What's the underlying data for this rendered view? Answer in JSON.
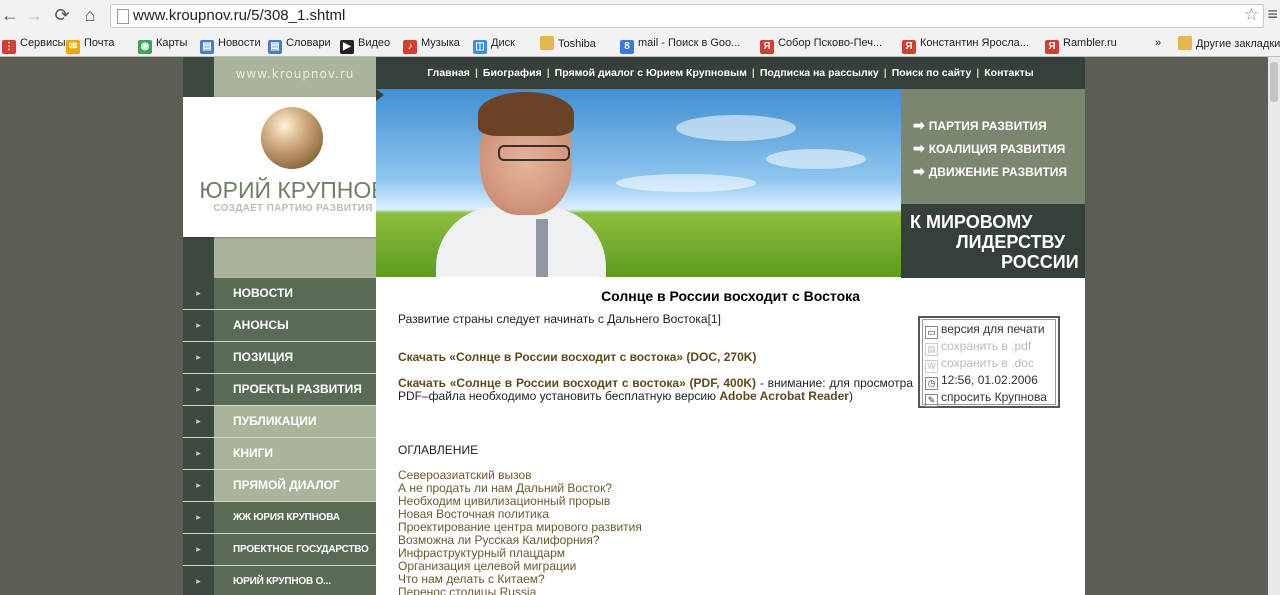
{
  "browser": {
    "url": "www.kroupnov.ru/5/308_1.shtml",
    "bookmarks": [
      {
        "label": "Сервисы",
        "icon": "apps-icon",
        "color": "#d23f31"
      },
      {
        "label": "Почта",
        "icon": "mail-icon",
        "color": "#f0a800"
      },
      {
        "label": "Карты",
        "icon": "maps-icon",
        "color": "#3aa757"
      },
      {
        "label": "Новости",
        "icon": "news-icon",
        "color": "#4a7bc8"
      },
      {
        "label": "Словари",
        "icon": "dictionary-icon",
        "color": "#4a7bc8"
      },
      {
        "label": "Видео",
        "icon": "video-icon",
        "color": "#222222"
      },
      {
        "label": "Музыка",
        "icon": "music-icon",
        "color": "#d23f31"
      },
      {
        "label": "Диск",
        "icon": "disk-icon",
        "color": "#3b8de0"
      },
      {
        "label": "Toshiba",
        "icon": "folder-icon",
        "color": "#e6b84b"
      },
      {
        "label": "mail - Поиск в Goo...",
        "icon": "google-icon",
        "color": "#3b78e7"
      },
      {
        "label": "Собор Псково-Печ...",
        "icon": "yandex-icon",
        "color": "#d23f31"
      },
      {
        "label": "Константин Яросла...",
        "icon": "yandex-icon",
        "color": "#d23f31"
      },
      {
        "label": "Rambler.ru",
        "icon": "yandex-icon",
        "color": "#d23f31"
      }
    ],
    "overflow": "»",
    "other_bookmarks": "Другие закладки"
  },
  "site": {
    "name": "www.kroupnov.ru",
    "logo_title": "ЮРИЙ КРУПНОВ",
    "logo_tagline": "СОЗДАЕТ ПАРТИЮ РАЗВИТИЯ",
    "topnav": [
      "Главная",
      "Биография",
      "Прямой диалог с Юрием Крупновым",
      "Подписка на рассылку",
      "Поиск по сайту",
      "Контакты"
    ],
    "right_links": [
      "ПАРТИЯ РАЗВИТИЯ",
      "КОАЛИЦИЯ РАЗВИТИЯ",
      "ДВИЖЕНИЕ РАЗВИТИЯ"
    ],
    "motto": [
      "К МИРОВОМУ",
      "ЛИДЕРСТВУ",
      "РОССИИ"
    ],
    "sidenav": [
      {
        "label": "НОВОСТИ",
        "style": "dark"
      },
      {
        "label": "АНОНСЫ",
        "style": "dark"
      },
      {
        "label": "ПОЗИЦИЯ",
        "style": "dark"
      },
      {
        "label": "ПРОЕКТЫ РАЗВИТИЯ",
        "style": "dark"
      },
      {
        "label": "ПУБЛИКАЦИИ",
        "style": "light"
      },
      {
        "label": "КНИГИ",
        "style": "light"
      },
      {
        "label": "ПРЯМОЙ ДИАЛОГ",
        "style": "light"
      },
      {
        "label": "ЖЖ ЮРИЯ КРУПНОВА",
        "style": "dark"
      },
      {
        "label": "ПРОЕКТНОЕ ГОСУДАРСТВО",
        "style": "dark"
      },
      {
        "label": "ЮРИЙ КРУПНОВ О...",
        "style": "dark"
      }
    ]
  },
  "article": {
    "title": "Солнце в России восходит с Востока",
    "lead": "Развитие страны следует начинать с Дальнего Востока[1]",
    "download_doc": "Скачать «Солнце в России восходит с востока» (DOC, 270K)",
    "download_pdf": "Скачать «Солнце в России восходит с востока» (PDF, 400K)",
    "pdf_note_a": " - внимание: для просмотра PDF–файла необходимо установить бесплатную версию ",
    "acrobat": "Adobe Acrobat Reader",
    "pdf_note_b": ")",
    "toc_heading": "ОГЛАВЛЕНИЕ",
    "toc": [
      "Североазиатский вызов",
      "А не продать ли нам Дальний Восток?",
      "Необходим цивилизационный прорыв",
      "Новая Восточная политика",
      "Проектирование центра мирового развития",
      "Возможна ли Русская Калифорния?",
      "Инфраструктурный плацдарм",
      "Организация целевой миграции",
      "Что нам делать с Китаем?",
      "Перенос столицы Russia"
    ]
  },
  "tools": [
    {
      "label": "версия для печати",
      "icon": "print-icon",
      "dim": false
    },
    {
      "label": "сохранить в .pdf",
      "icon": "pdf-icon",
      "dim": true
    },
    {
      "label": "сохранить в .doc",
      "icon": "doc-icon",
      "dim": true
    },
    {
      "label": "12:56, 01.02.2006",
      "icon": "clock-icon",
      "dim": false
    },
    {
      "label": "спросить Крупнова",
      "icon": "ask-icon",
      "dim": false
    }
  ]
}
